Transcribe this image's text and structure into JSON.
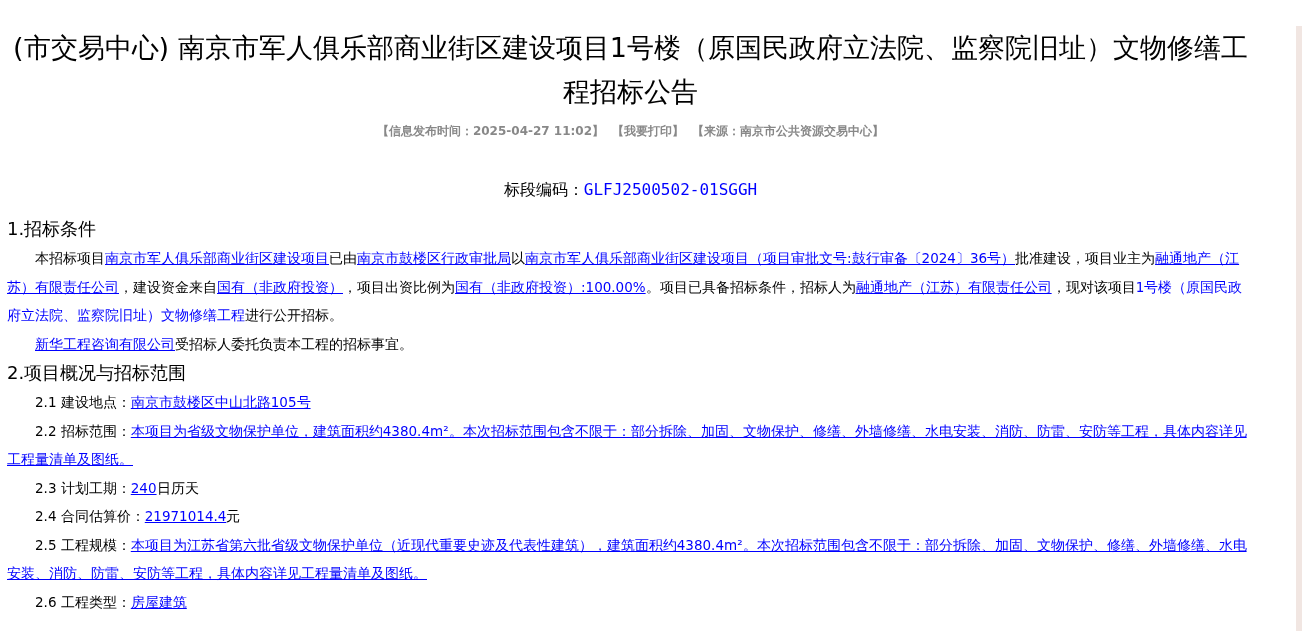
{
  "title": "(市交易中心) 南京市军人俱乐部商业街区建设项目1号楼（原国民政府立法院、监察院旧址）文物修缮工程招标公告",
  "meta": [
    "【信息发布时间：2025-04-27 11:02】",
    "【我要打印】",
    "【来源：南京市公共资源交易中心】"
  ],
  "section_code": {
    "label": "标段编码：",
    "value": "GLFJ2500502-01SGGH"
  },
  "sections": [
    {
      "heading": "1.招标条件",
      "paragraphs": [
        {
          "segments": [
            {
              "kind": "plain",
              "text": "本招标项目"
            },
            {
              "kind": "link",
              "text": "南京市军人俱乐部商业街区建设项目"
            },
            {
              "kind": "plain",
              "text": "已由"
            },
            {
              "kind": "link",
              "text": "南京市鼓楼区行政审批局"
            },
            {
              "kind": "plain",
              "text": "以"
            },
            {
              "kind": "link",
              "text": "南京市军人俱乐部商业街区建设项目（项目审批文号:鼓行审备〔2024〕36号）"
            },
            {
              "kind": "plain",
              "text": "批准建设，项目业主为"
            },
            {
              "kind": "link",
              "text": "融通地产（江苏）有限责任公司"
            },
            {
              "kind": "plain",
              "text": "，建设资金来自"
            },
            {
              "kind": "link",
              "text": "国有（非政府投资）"
            },
            {
              "kind": "plain",
              "text": "，项目出资比例为"
            },
            {
              "kind": "link",
              "text": "国有（非政府投资）:100.00%"
            },
            {
              "kind": "plain",
              "text": "。项目已具备招标条件，招标人为"
            },
            {
              "kind": "link",
              "text": "融通地产（江苏）有限责任公司"
            },
            {
              "kind": "plain",
              "text": "，现对该项目"
            },
            {
              "kind": "accent",
              "text": "1号楼（原国民政府立法院、监察院旧址）文物修缮工程"
            },
            {
              "kind": "plain",
              "text": "进行公开招标。"
            }
          ]
        },
        {
          "segments": [
            {
              "kind": "link",
              "text": "新华工程咨询有限公司"
            },
            {
              "kind": "plain",
              "text": "受招标人委托负责本工程的招标事宜。"
            }
          ]
        }
      ]
    },
    {
      "heading": "2.项目概况与招标范围",
      "paragraphs": [
        {
          "segments": [
            {
              "kind": "plain",
              "text": "2.1 建设地点："
            },
            {
              "kind": "link",
              "text": "南京市鼓楼区中山北路105号"
            }
          ]
        },
        {
          "segments": [
            {
              "kind": "plain",
              "text": "2.2 招标范围："
            },
            {
              "kind": "link",
              "text": "本项目为省级文物保护单位，建筑面积约4380.4m²。本次招标范围包含不限于：部分拆除、加固、文物保护、修缮、外墙修缮、水电安装、消防、防雷、安防等工程，具体内容详见工程量清单及图纸。"
            }
          ]
        },
        {
          "segments": [
            {
              "kind": "plain",
              "text": "2.3 计划工期："
            },
            {
              "kind": "link",
              "text": "240"
            },
            {
              "kind": "plain",
              "text": "日历天"
            }
          ]
        },
        {
          "segments": [
            {
              "kind": "plain",
              "text": "2.4 合同估算价："
            },
            {
              "kind": "link",
              "text": "21971014.4"
            },
            {
              "kind": "plain",
              "text": "元"
            }
          ]
        },
        {
          "segments": [
            {
              "kind": "plain",
              "text": "2.5 工程规模："
            },
            {
              "kind": "link",
              "text": "本项目为江苏省第六批省级文物保护单位（近现代重要史迹及代表性建筑），建筑面积约4380.4m²。本次招标范围包含不限于：部分拆除、加固、文物保护、修缮、外墙修缮、水电安装、消防、防雷、安防等工程，具体内容详见工程量清单及图纸。"
            }
          ]
        },
        {
          "segments": [
            {
              "kind": "plain",
              "text": "2.6 工程类型："
            },
            {
              "kind": "link",
              "text": "房屋建筑"
            }
          ]
        }
      ]
    }
  ]
}
